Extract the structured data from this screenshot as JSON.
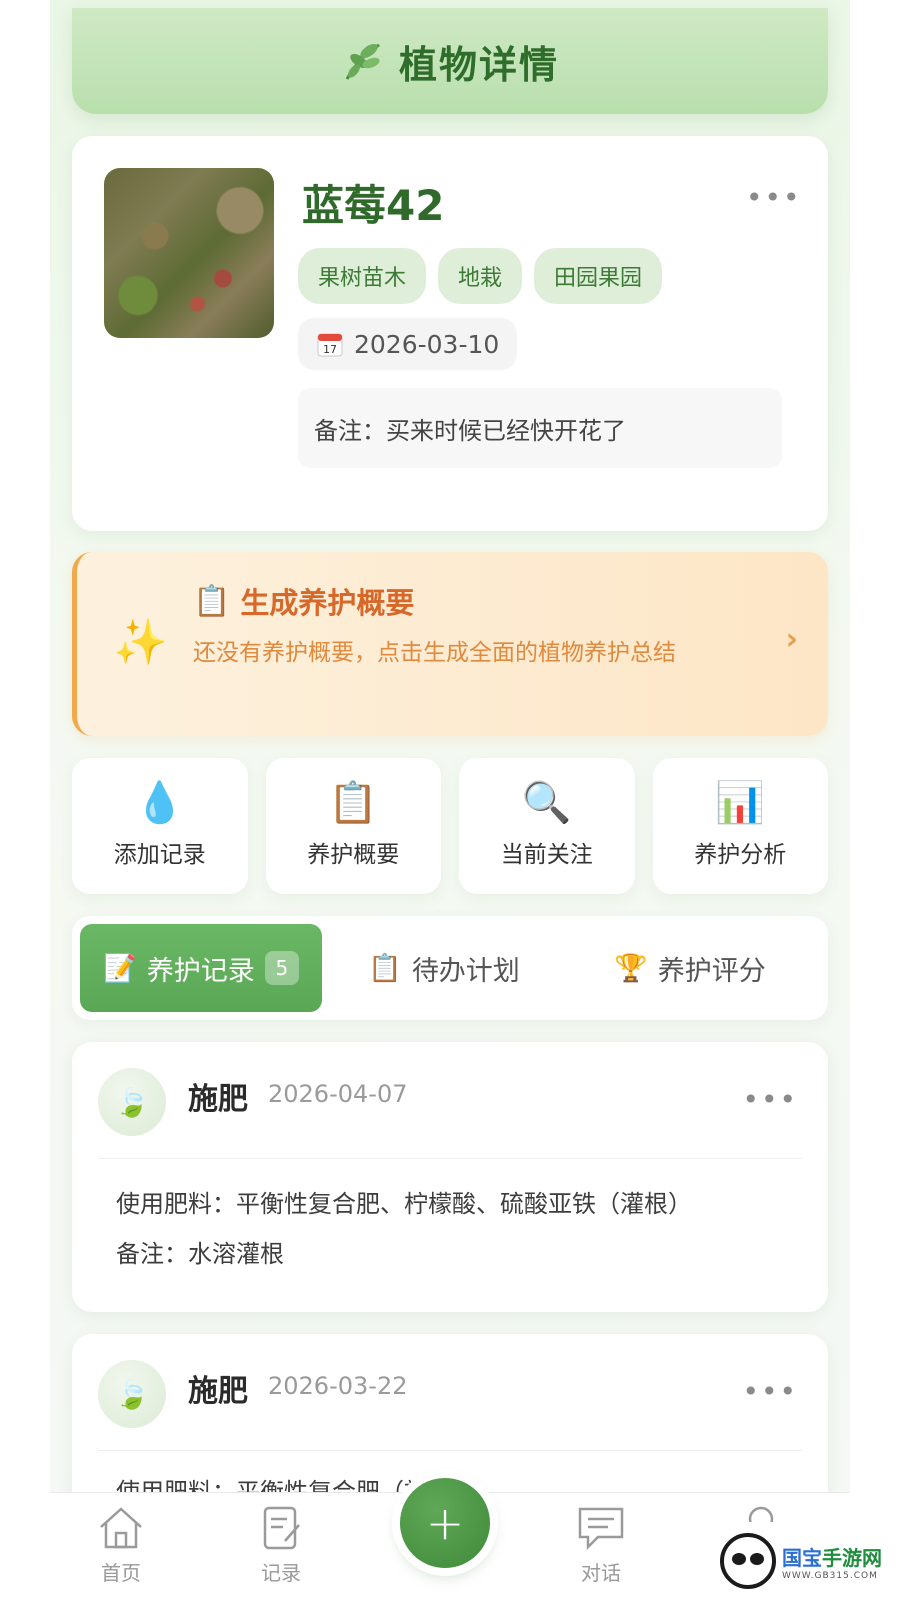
{
  "header": {
    "icon": "leaf-icon",
    "title": "植物详情"
  },
  "plant": {
    "name": "蓝莓42",
    "tags": [
      "果树苗木",
      "地栽",
      "田园果园"
    ],
    "date": "2026-03-10",
    "note": "备注：买来时候已经快开花了"
  },
  "summary": {
    "title": "生成养护概要",
    "desc": "还没有养护概要，点击生成全面的植物养护总结"
  },
  "actions": [
    {
      "icon": "water-drop-icon",
      "glyph": "💧",
      "label": "添加记录"
    },
    {
      "icon": "clipboard-icon",
      "glyph": "📋",
      "label": "养护概要"
    },
    {
      "icon": "magnifier-icon",
      "glyph": "🔍",
      "label": "当前关注"
    },
    {
      "icon": "bar-chart-icon",
      "glyph": "📊",
      "label": "养护分析"
    }
  ],
  "tabs": {
    "records": {
      "label": "养护记录",
      "count": "5"
    },
    "todo": {
      "label": "待办计划"
    },
    "score": {
      "label": "养护评分"
    }
  },
  "records": [
    {
      "type": "施肥",
      "date": "2026-04-07",
      "line1": "使用肥料：平衡性复合肥、柠檬酸、硫酸亚铁（灌根）",
      "line2": "备注：水溶灌根"
    },
    {
      "type": "施肥",
      "date": "2026-03-22",
      "line1": "使用肥料：平衡性复合肥（施撒）"
    }
  ],
  "nav": {
    "home": "首页",
    "records": "记录",
    "chat": "对话"
  },
  "watermark": {
    "title_a": "国宝",
    "title_b": "手游网",
    "sub": "WWW.GB315.COM"
  },
  "colors": {
    "brand_green": "#5aa855",
    "header_green": "#2f6d2a",
    "orange": "#d8682a"
  }
}
